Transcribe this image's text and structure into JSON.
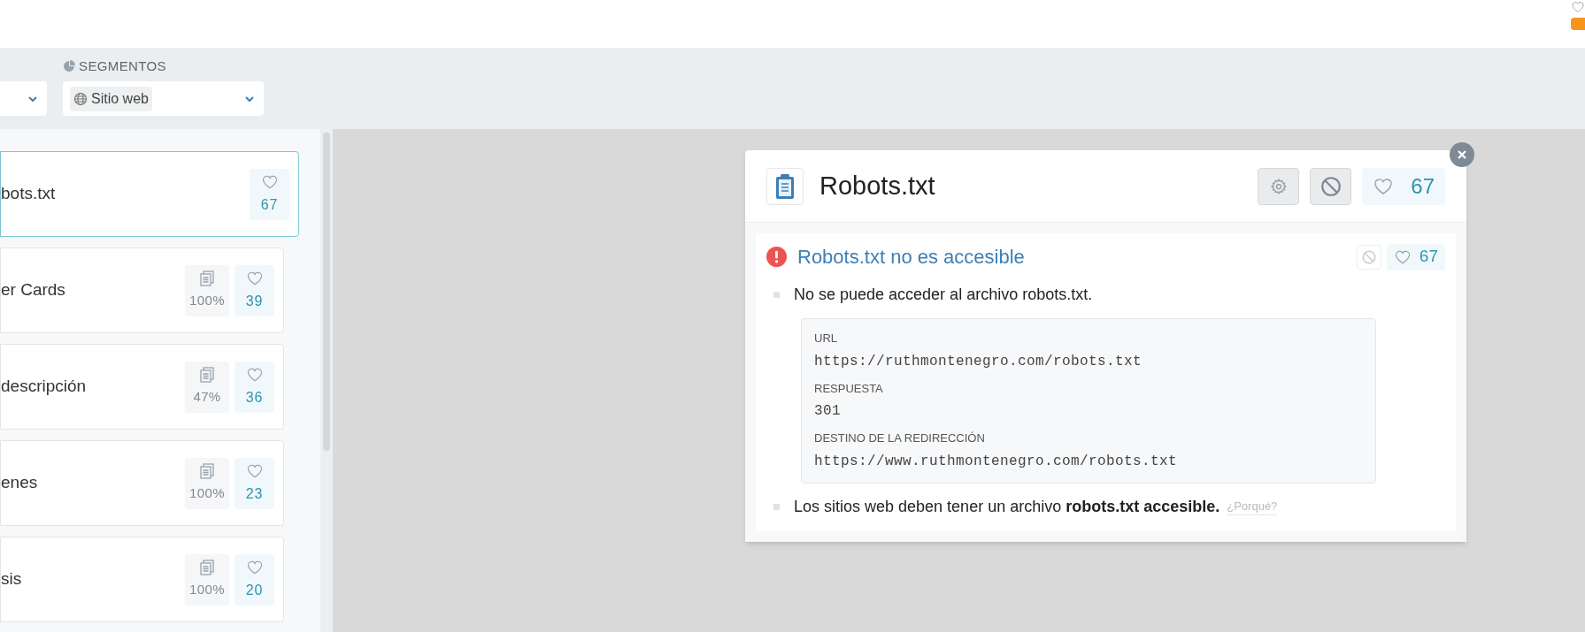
{
  "filters": {
    "segment_label": "SEGMENTOS",
    "segment_value": "Sitio web"
  },
  "checks": [
    {
      "title": "bots.txt",
      "selected": true,
      "score": "67"
    },
    {
      "title": "er Cards",
      "selected": false,
      "coverage": "100%",
      "score": "39"
    },
    {
      "title": "descripción",
      "selected": false,
      "coverage": "47%",
      "score": "36"
    },
    {
      "title": "enes",
      "selected": false,
      "coverage": "100%",
      "score": "23"
    },
    {
      "title": "sis",
      "selected": false,
      "coverage": "100%",
      "score": "20"
    }
  ],
  "detail": {
    "title": "Robots.txt",
    "score": "67",
    "issue": {
      "title": "Robots.txt no es accesible",
      "score": "67",
      "bullets": [
        {
          "kind": "text",
          "text": "No se puede acceder al archivo robots.txt."
        },
        {
          "kind": "details",
          "fields": [
            {
              "label": "URL",
              "value": "https://ruthmontenegro.com/robots.txt"
            },
            {
              "label": "RESPUESTA",
              "value": "301"
            },
            {
              "label": "DESTINO DE LA REDIRECCIÓN",
              "value": "https://www.ruthmontenegro.com/robots.txt"
            }
          ]
        },
        {
          "kind": "text",
          "text": "Los sitios web deben tener un archivo **robots.txt accesible.**",
          "link": "¿Porqué?"
        }
      ]
    }
  }
}
